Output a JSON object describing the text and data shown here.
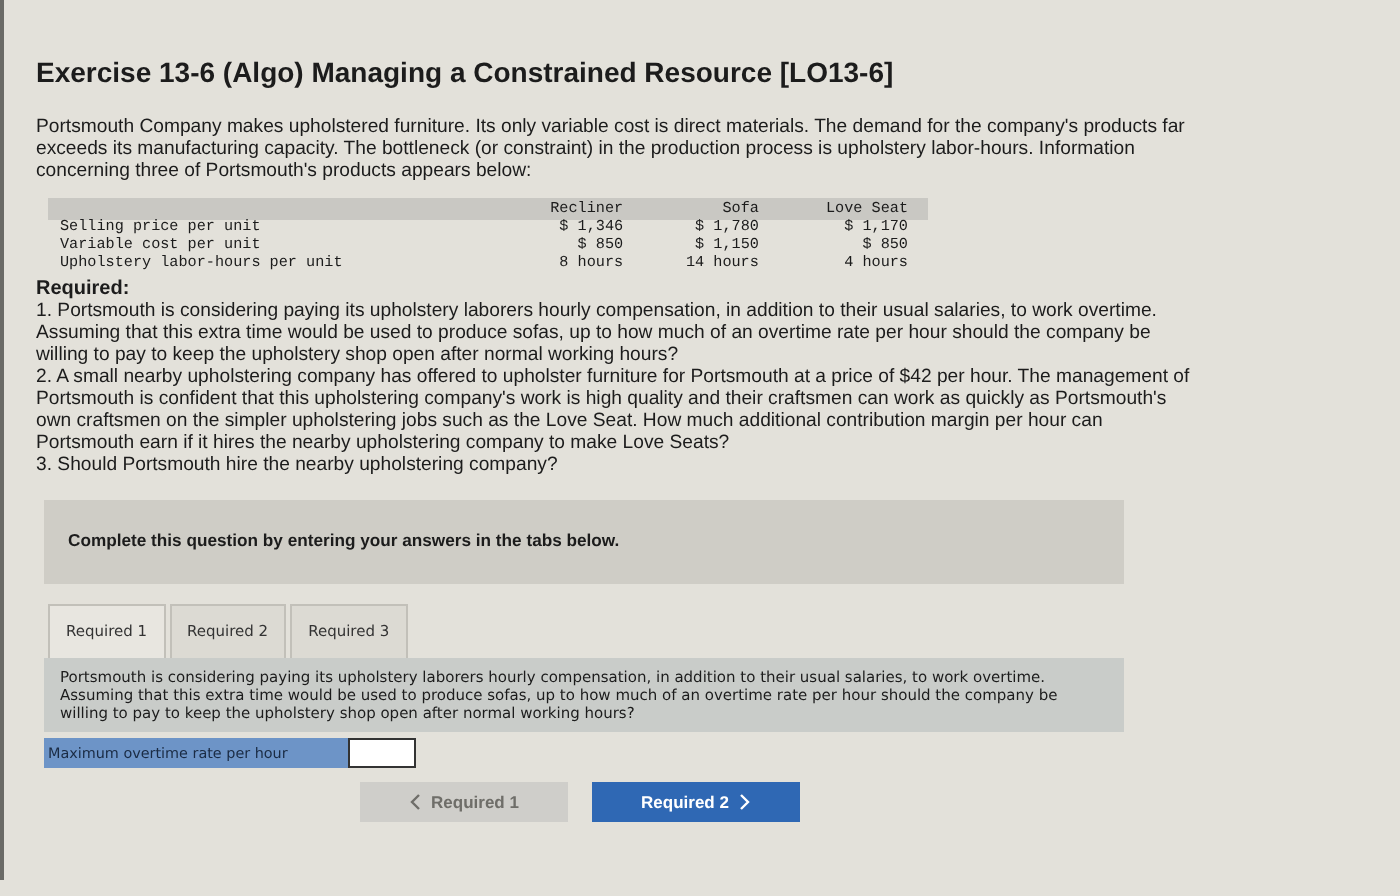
{
  "title": "Exercise 13-6 (Algo) Managing a Constrained Resource [LO13-6]",
  "intro": "Portsmouth Company makes upholstered furniture. Its only variable cost is direct materials. The demand for the company's products far exceeds its manufacturing capacity. The bottleneck (or constraint) in the production process is upholstery labor-hours. Information concerning three of Portsmouth's products appears below:",
  "table": {
    "columns": [
      "Recliner",
      "Sofa",
      "Love Seat"
    ],
    "rows": [
      {
        "label": "Selling price per unit",
        "cells": [
          "$ 1,346",
          "$ 1,780",
          "$ 1,170"
        ]
      },
      {
        "label": "Variable cost per unit",
        "cells": [
          "$ 850",
          "$ 1,150",
          "$ 850"
        ]
      },
      {
        "label": "Upholstery labor-hours per unit",
        "cells": [
          "8 hours",
          "14 hours",
          "4 hours"
        ]
      }
    ]
  },
  "required": {
    "heading": "Required:",
    "items": [
      "1. Portsmouth is considering paying its upholstery laborers hourly compensation, in addition to their usual salaries, to work overtime. Assuming that this extra time would be used to produce sofas, up to how much of an overtime rate per hour should the company be willing to pay to keep the upholstery shop open after normal working hours?",
      "2. A small nearby upholstering company has offered to upholster furniture for Portsmouth at a price of $42 per hour. The management of Portsmouth is confident that this upholstering company's work is high quality and their craftsmen can work as quickly as Portsmouth's own craftsmen on the simpler upholstering jobs such as the Love Seat. How much additional contribution margin per hour can Portsmouth earn if it hires the nearby upholstering company to make Love Seats?",
      "3. Should Portsmouth hire the nearby upholstering company?"
    ]
  },
  "instruction": "Complete this question by entering your answers in the tabs below.",
  "tabs": [
    {
      "label": "Required 1",
      "selected": true
    },
    {
      "label": "Required 2",
      "selected": false
    },
    {
      "label": "Required 3",
      "selected": false
    }
  ],
  "question": "Portsmouth is considering paying its upholstery laborers hourly compensation, in addition to their usual salaries, to work overtime. Assuming that this extra time would be used to produce sofas, up to how much of an overtime rate per hour should the company be willing to pay to keep the upholstery shop open after normal working hours?",
  "answer": {
    "label": "Maximum overtime rate per hour"
  },
  "nav": [
    {
      "label": "Required 1",
      "kind": "prev",
      "disabled": true
    },
    {
      "label": "Required 2",
      "kind": "next",
      "disabled": false
    }
  ]
}
